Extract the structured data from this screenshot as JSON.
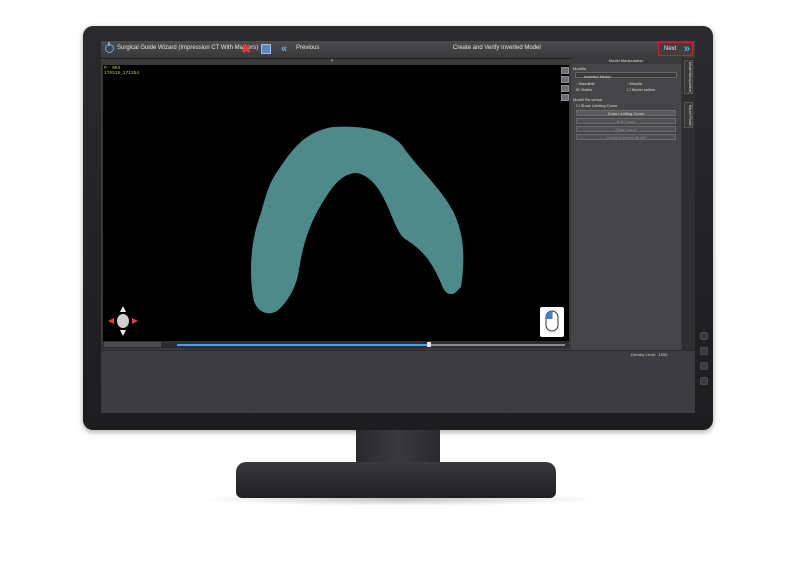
{
  "titlebar": {
    "app_title": "Surgical Guide Wizard (Impression CT With Markers)",
    "previous_label": "Previous",
    "step_title": "Create and Verify Inverted Model",
    "next_label": "Next"
  },
  "viewport": {
    "coord_line1": "P: 003",
    "coord_line2": "170515_171354"
  },
  "panel": {
    "header": "Model Manipulation",
    "models_section": "Models",
    "model_dropdown": "Inverted Model",
    "mandible_label": "Mandible",
    "maxilla_label": "Maxilla",
    "visible_label": "Visible",
    "model_outline_label": "Model outline",
    "model_reversal_section": "Model Re-virtual",
    "show_limiting_curve_label": "Show Limiting Curve",
    "draw_limiting_curve_button": "Draw Limiting Curve",
    "edit_curve_button": "Edit Curve",
    "clear_curve_button": "Clear Curve",
    "create_inverted_model_button": "Create Inverted Model"
  },
  "vertical_tabs": {
    "tab1": "Model Manipulation",
    "tab2": "Report Panel"
  },
  "status": {
    "density_level": "Density Level: -1000"
  },
  "timeline": {
    "progress": 0.65
  },
  "colors": {
    "model_fill": "#4f8a8b",
    "accent_blue": "#4aa1e6",
    "next_border": "#d2201e"
  }
}
